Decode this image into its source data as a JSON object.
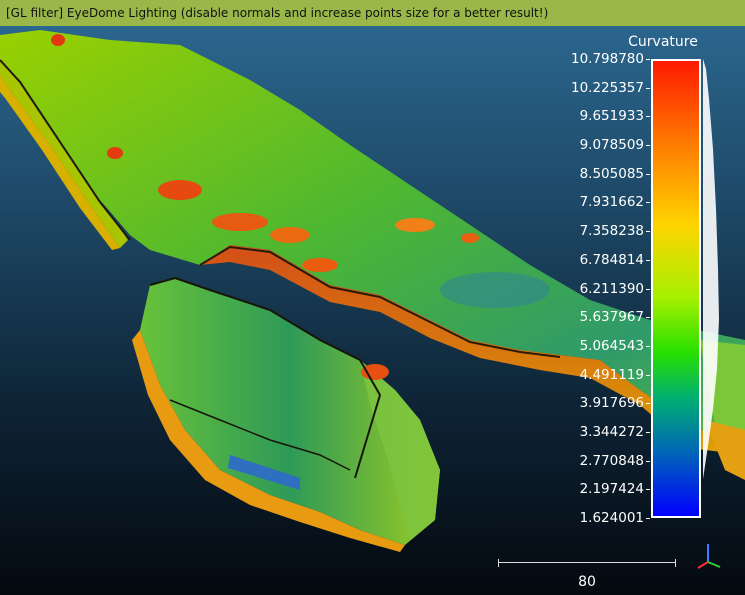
{
  "banner": {
    "text": "[GL filter] EyeDome Lighting (disable normals and increase points size for a better result!)"
  },
  "colorbar": {
    "title": "Curvature",
    "labels": [
      "10.798780",
      "10.225357",
      "9.651933",
      "9.078509",
      "8.505085",
      "7.931662",
      "7.358238",
      "6.784814",
      "6.211390",
      "5.637967",
      "5.064543",
      "4.491119",
      "3.917696",
      "3.344272",
      "2.770848",
      "2.197424",
      "1.624001"
    ],
    "min": 1.624001,
    "max": 10.79878,
    "colors": [
      "#ff1a00",
      "#ff7a00",
      "#ffd400",
      "#28e000",
      "#0066b8",
      "#0000ff"
    ]
  },
  "scale": {
    "label": "80"
  },
  "axes_icon": "xyz-axes-icon"
}
